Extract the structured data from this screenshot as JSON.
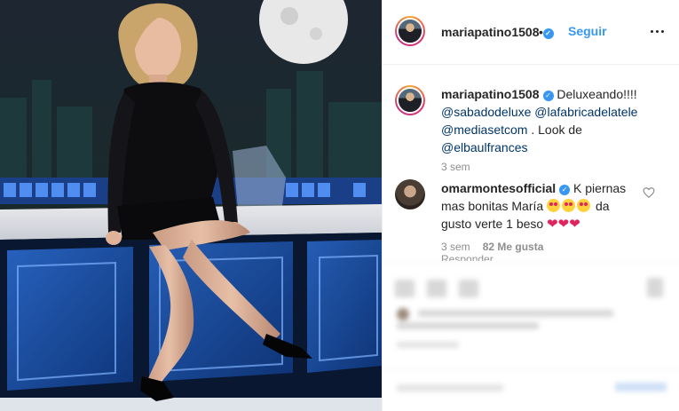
{
  "post": {
    "author": "mariapatino1508",
    "follow_separator": "•",
    "follow_label": "Seguir",
    "caption": {
      "author": "mariapatino1508",
      "text": "Deluxeando!!!!",
      "mentions": [
        "@sabadodeluxe",
        "@lafabricadelatele",
        "@mediasetcom"
      ],
      "text_after": ". Look de",
      "last_mention": "@elbaulfrances",
      "time": "3 sem"
    },
    "comment": {
      "author": "omarmontesofficial",
      "text_1": "K piernas mas bonitas María",
      "text_2": "da gusto verte 1 beso",
      "time": "3 sem",
      "likes": "82 Me gusta",
      "replies_label": "Responder"
    }
  },
  "colors": {
    "accent": "#3897f0",
    "mention": "#003569",
    "muted": "#8e8e8e"
  },
  "icons": {
    "verified": "verified-badge-icon",
    "more": "more-options-icon",
    "like": "heart-outline-icon"
  }
}
